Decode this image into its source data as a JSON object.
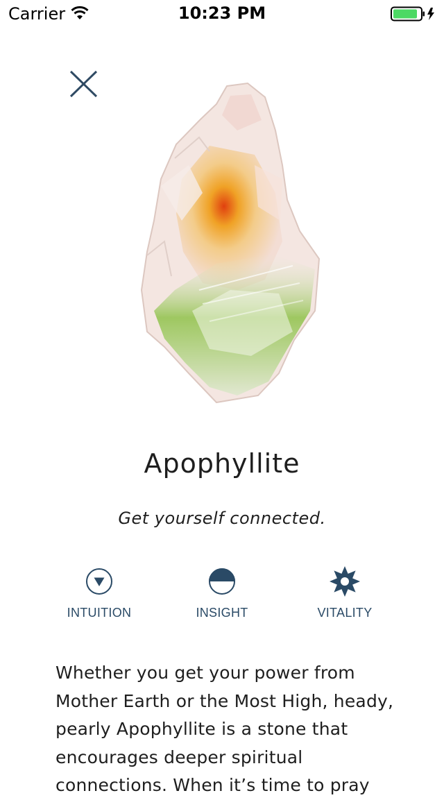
{
  "status_bar": {
    "carrier": "Carrier",
    "time": "10:23 PM",
    "battery_color": "#4cd964"
  },
  "detail": {
    "close_icon": "close-icon",
    "image": "apophyllite-crystal",
    "title": "Apophyllite",
    "tagline": "Get yourself connected.",
    "attributes": [
      {
        "label": "INTUITION",
        "icon": "down-triangle-circle-icon"
      },
      {
        "label": "INSIGHT",
        "icon": "half-circle-icon"
      },
      {
        "label": "VITALITY",
        "icon": "sun-gear-icon"
      }
    ],
    "description": "Whether you get your power from Mother Earth or the Most High, heady, pearly Apophyllite is a stone that encourages deeper spiritual connections. When it’s time to pray",
    "accent_color": "#2a4a66"
  }
}
